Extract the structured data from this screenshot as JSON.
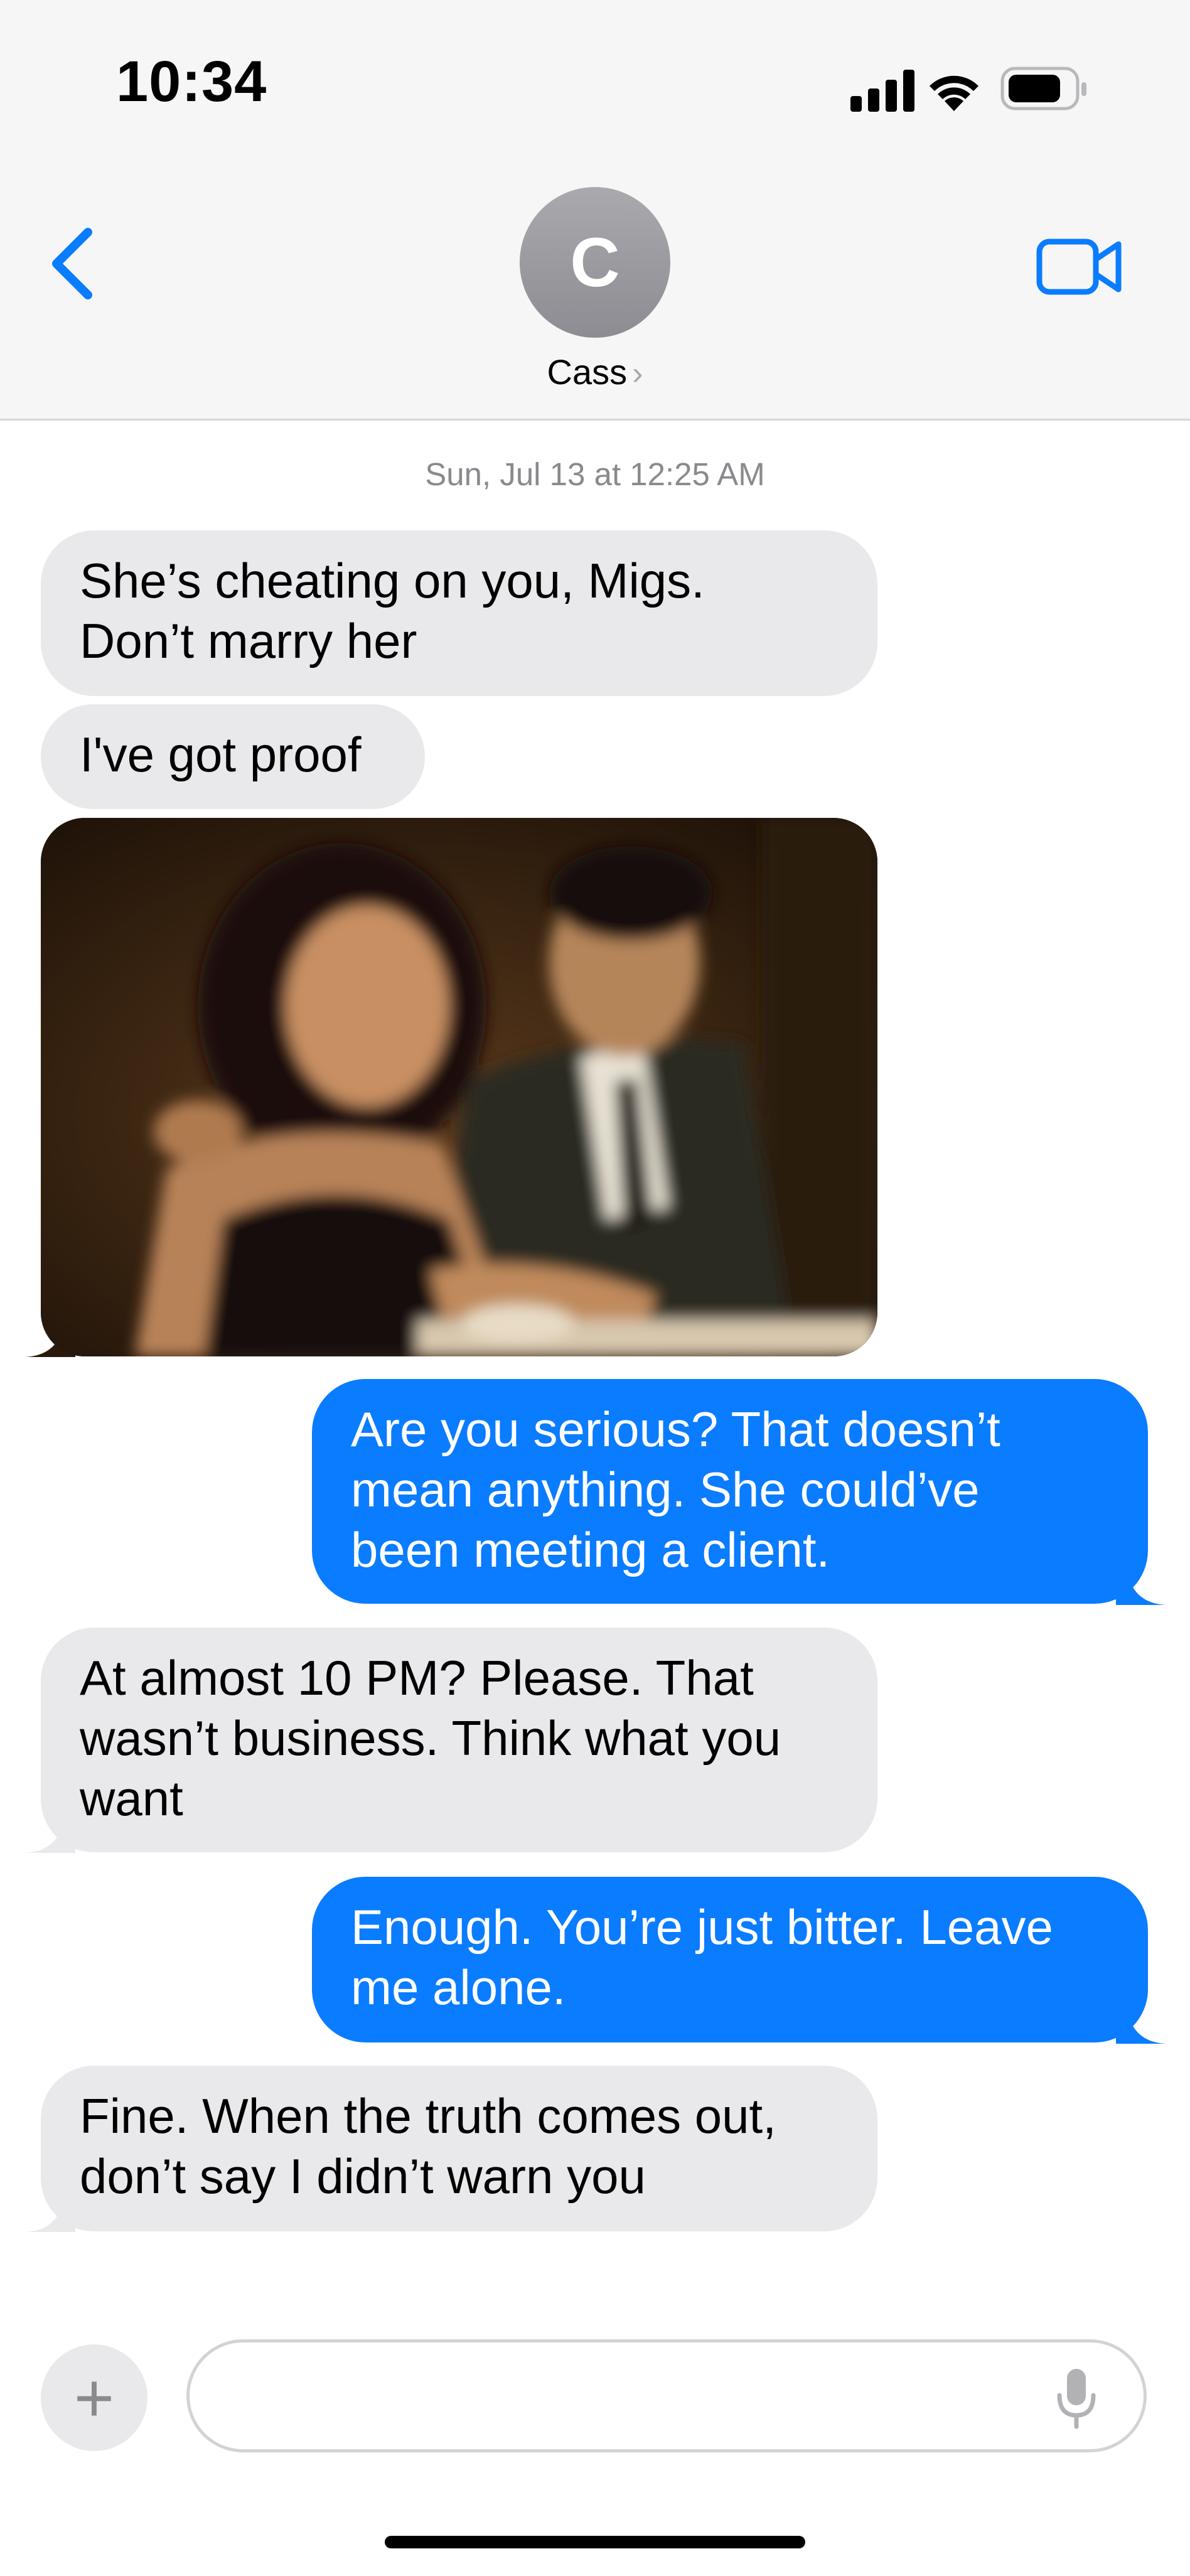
{
  "status_bar": {
    "time": "10:34"
  },
  "header": {
    "avatar_initial": "C",
    "contact_name": "Cass",
    "chevron": "›",
    "icons": {
      "back": "chevron-left-icon",
      "video": "video-camera-icon"
    }
  },
  "conversation": {
    "timestamp": "Sun, Jul 13 at 12:25 AM",
    "messages": [
      {
        "from": "them",
        "lines": [
          "She’s cheating on you, Migs.",
          "Don’t marry her"
        ]
      },
      {
        "from": "them",
        "lines": [
          "I've got proof"
        ]
      },
      {
        "from": "them",
        "type": "photo"
      },
      {
        "from": "me",
        "lines": [
          "Are you serious? That doesn’t",
          "mean anything. She could’ve",
          "been meeting a client."
        ]
      },
      {
        "from": "them",
        "lines": [
          "At almost 10 PM? Please. That",
          "wasn’t business. Think what you",
          "want"
        ]
      },
      {
        "from": "me",
        "lines": [
          "Enough. You’re just bitter. Leave",
          "me alone."
        ]
      },
      {
        "from": "them",
        "lines": [
          "Fine. When the truth comes out,",
          "don’t say I didn’t warn you"
        ]
      }
    ]
  },
  "composer": {
    "plus_label": "+",
    "input_value": "",
    "icons": {
      "plus": "plus-icon",
      "mic": "microphone-icon"
    }
  },
  "colors": {
    "outgoing": "#0a7cff",
    "incoming": "#e9e9eb",
    "accent": "#0a7cff"
  }
}
